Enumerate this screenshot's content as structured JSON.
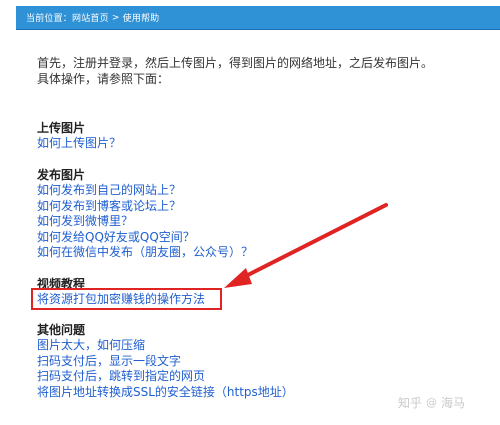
{
  "breadcrumb": {
    "prefix": "当前位置：",
    "home": "网站首页",
    "separator": ">",
    "current": "使用帮助"
  },
  "intro": {
    "line1": "首先，注册并登录，然后上传图片，得到图片的网络地址，之后发布图片。",
    "line2": "具体操作，请参照下面："
  },
  "sections": {
    "upload": {
      "title": "上传图片",
      "links": [
        "如何上传图片？"
      ]
    },
    "publish": {
      "title": "发布图片",
      "links": [
        "如何发布到自己的网站上？",
        "如何发布到博客或论坛上？",
        "如何发到微博里？",
        "如何发给QQ好友或QQ空间？",
        "如何在微信中发布（朋友圈，公众号）？"
      ]
    },
    "video": {
      "title": "视频教程",
      "links": [
        "将资源打包加密赚钱的操作方法"
      ]
    },
    "other": {
      "title": "其他问题",
      "links": [
        "图片太大，如何压缩",
        "扫码支付后，显示一段文字",
        "扫码支付后，跳转到指定的网页",
        "将图片地址转换成SSL的安全链接（https地址）"
      ]
    }
  },
  "watermark": {
    "site": "知乎",
    "at": "@",
    "author": "海马"
  },
  "colors": {
    "header_bg": "#2f91d6",
    "link": "#1f5fd0",
    "highlight": "#e02424"
  }
}
